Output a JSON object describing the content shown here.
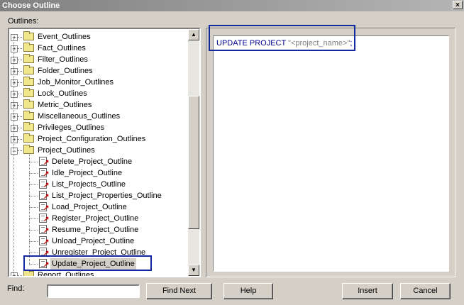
{
  "window": {
    "title": "Choose Outline",
    "close": "×"
  },
  "outlines_label": "Outlines:",
  "tree": {
    "folders_before": [
      "Event_Outlines",
      "Fact_Outlines",
      "Filter_Outlines",
      "Folder_Outlines",
      "Job_Monitor_Outlines",
      "Lock_Outlines",
      "Metric_Outlines",
      "Miscellaneous_Outlines",
      "Privileges_Outlines",
      "Project_Configuration_Outlines"
    ],
    "expanded_folder": "Project_Outlines",
    "children": [
      "Delete_Project_Outline",
      "Idle_Project_Outline",
      "List_Projects_Outline",
      "List_Project_Properties_Outline",
      "Load_Project_Outline",
      "Register_Project_Outline",
      "Resume_Project_Outline",
      "Unload_Project_Outline",
      "Unregister_Project_Outline",
      "Update_Project_Outline"
    ],
    "folders_after": [
      "Report_Outlines"
    ],
    "selected": "Update_Project_Outline"
  },
  "editor": {
    "keyword": "UPDATE PROJECT ",
    "string": "\"<project_name>\"",
    "terminator": ";"
  },
  "find": {
    "label": "Find:",
    "value": ""
  },
  "buttons": {
    "find_next": "Find Next",
    "help": "Help",
    "insert": "Insert",
    "cancel": "Cancel"
  },
  "colors": {
    "highlight": "#1428a0",
    "keyword": "#00008b"
  }
}
